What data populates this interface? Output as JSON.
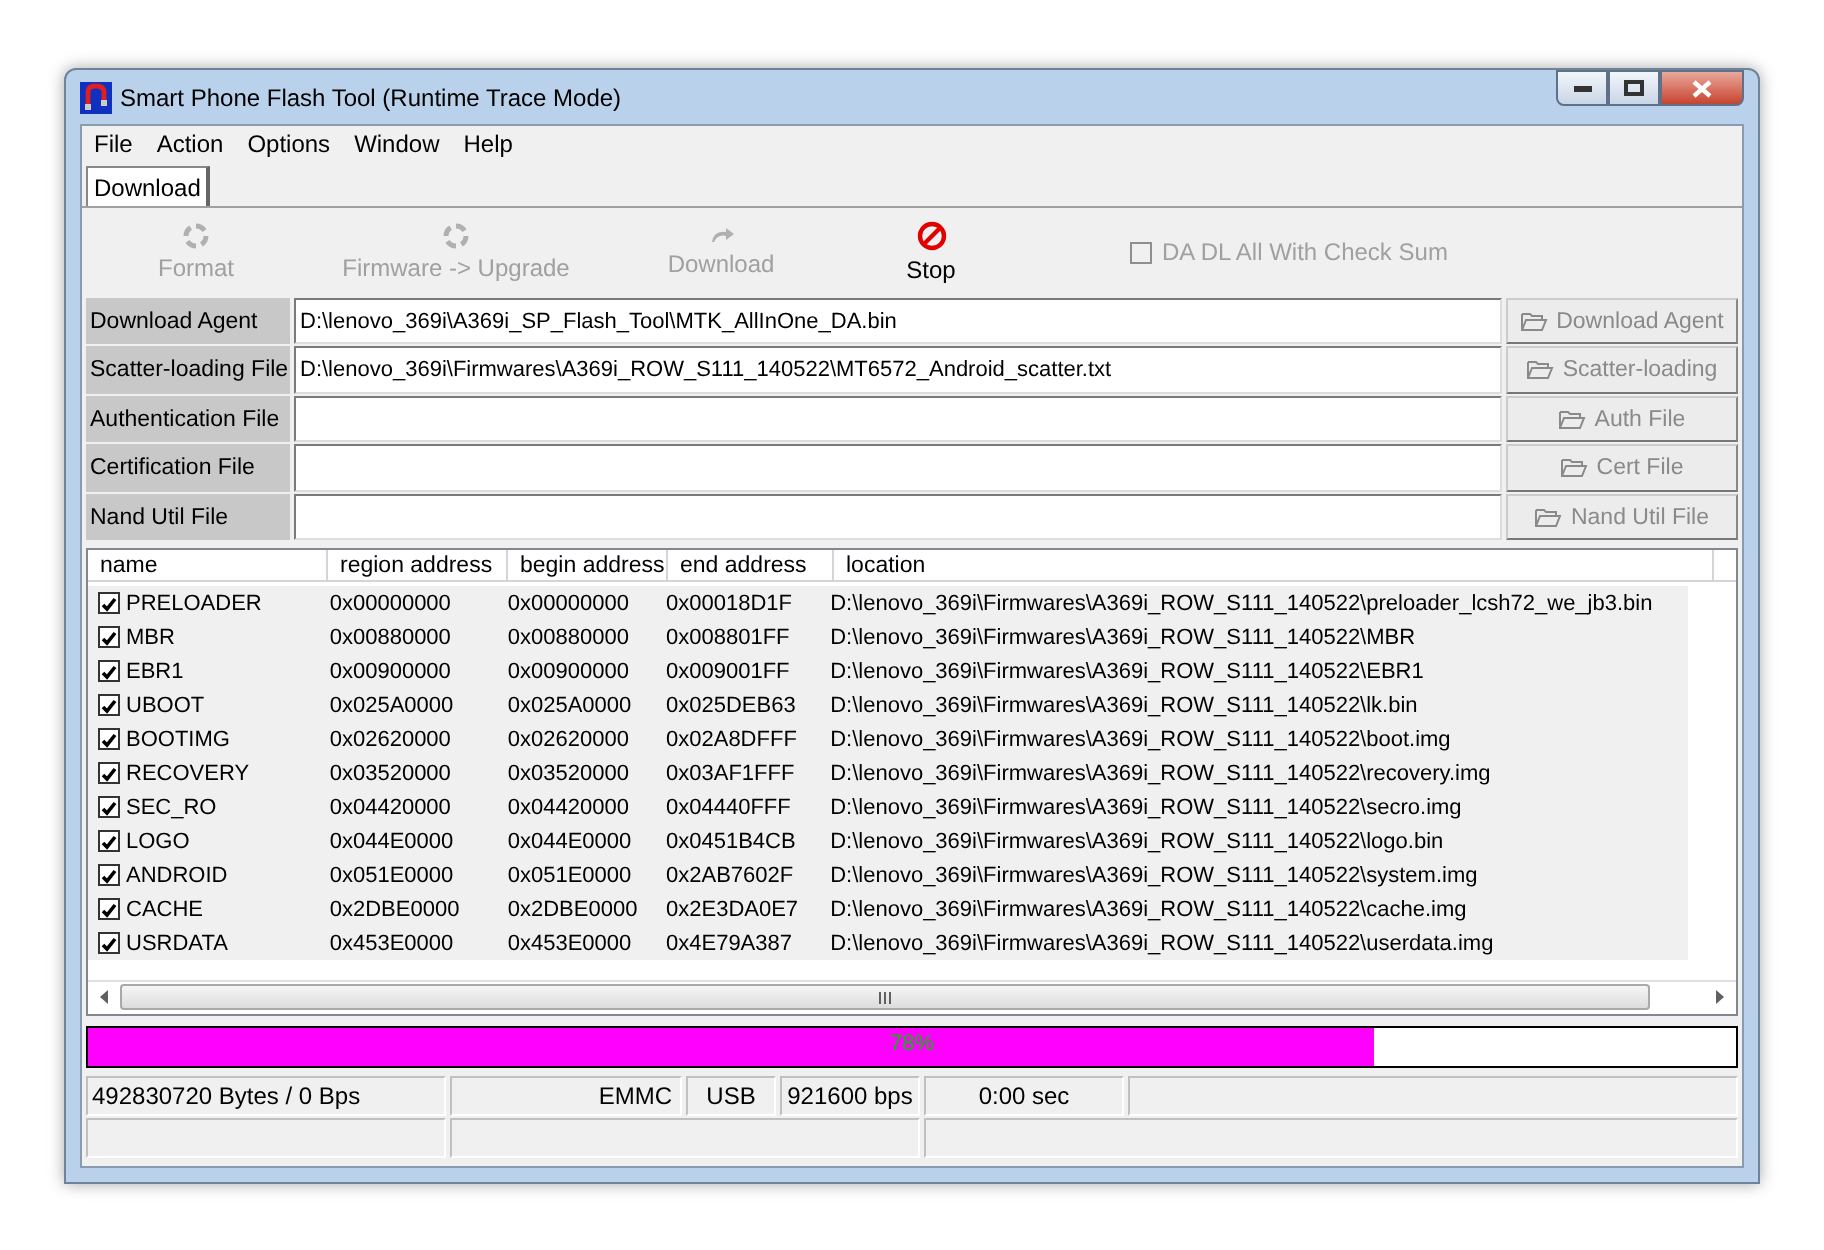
{
  "window": {
    "title": "Smart Phone Flash Tool (Runtime Trace Mode)"
  },
  "menu": [
    "File",
    "Action",
    "Options",
    "Window",
    "Help"
  ],
  "tabs": [
    {
      "label": "Download",
      "selected": true
    }
  ],
  "toolbar": [
    {
      "kind": "format",
      "label": "Format",
      "disabled": true
    },
    {
      "kind": "upgrade",
      "label": "Firmware -> Upgrade",
      "disabled": true
    },
    {
      "kind": "download",
      "label": "Download",
      "disabled": true
    },
    {
      "kind": "stop",
      "label": "Stop",
      "disabled": false
    }
  ],
  "checksum": {
    "label": "DA DL All With Check Sum",
    "checked": false,
    "disabled": true
  },
  "file_rows": [
    {
      "label": "Download Agent",
      "value": "D:\\lenovo_369i\\A369i_SP_Flash_Tool\\MTK_AllInOne_DA.bin",
      "button": "Download Agent"
    },
    {
      "label": "Scatter-loading File",
      "value": "D:\\lenovo_369i\\Firmwares\\A369i_ROW_S111_140522\\MT6572_Android_scatter.txt",
      "button": "Scatter-loading"
    },
    {
      "label": "Authentication File",
      "button": "Auth File"
    },
    {
      "label": "Certification File",
      "button": "Cert File"
    },
    {
      "label": "Nand Util File",
      "button": "Nand Util File"
    }
  ],
  "table": {
    "columns": [
      "name",
      "region address",
      "begin address",
      "end address",
      "location"
    ],
    "rows": [
      {
        "checked": true,
        "name": "PRELOADER",
        "region": "0x00000000",
        "begin": "0x00000000",
        "end": "0x00018D1F",
        "location": "D:\\lenovo_369i\\Firmwares\\A369i_ROW_S111_140522\\preloader_lcsh72_we_jb3.bin"
      },
      {
        "checked": true,
        "name": "MBR",
        "region": "0x00880000",
        "begin": "0x00880000",
        "end": "0x008801FF",
        "location": "D:\\lenovo_369i\\Firmwares\\A369i_ROW_S111_140522\\MBR"
      },
      {
        "checked": true,
        "name": "EBR1",
        "region": "0x00900000",
        "begin": "0x00900000",
        "end": "0x009001FF",
        "location": "D:\\lenovo_369i\\Firmwares\\A369i_ROW_S111_140522\\EBR1"
      },
      {
        "checked": true,
        "name": "UBOOT",
        "region": "0x025A0000",
        "begin": "0x025A0000",
        "end": "0x025DEB63",
        "location": "D:\\lenovo_369i\\Firmwares\\A369i_ROW_S111_140522\\lk.bin"
      },
      {
        "checked": true,
        "name": "BOOTIMG",
        "region": "0x02620000",
        "begin": "0x02620000",
        "end": "0x02A8DFFF",
        "location": "D:\\lenovo_369i\\Firmwares\\A369i_ROW_S111_140522\\boot.img"
      },
      {
        "checked": true,
        "name": "RECOVERY",
        "region": "0x03520000",
        "begin": "0x03520000",
        "end": "0x03AF1FFF",
        "location": "D:\\lenovo_369i\\Firmwares\\A369i_ROW_S111_140522\\recovery.img"
      },
      {
        "checked": true,
        "name": "SEC_RO",
        "region": "0x04420000",
        "begin": "0x04420000",
        "end": "0x04440FFF",
        "location": "D:\\lenovo_369i\\Firmwares\\A369i_ROW_S111_140522\\secro.img"
      },
      {
        "checked": true,
        "name": "LOGO",
        "region": "0x044E0000",
        "begin": "0x044E0000",
        "end": "0x0451B4CB",
        "location": "D:\\lenovo_369i\\Firmwares\\A369i_ROW_S111_140522\\logo.bin"
      },
      {
        "checked": true,
        "name": "ANDROID",
        "region": "0x051E0000",
        "begin": "0x051E0000",
        "end": "0x2AB7602F",
        "location": "D:\\lenovo_369i\\Firmwares\\A369i_ROW_S111_140522\\system.img"
      },
      {
        "checked": true,
        "name": "CACHE",
        "region": "0x2DBE0000",
        "begin": "0x2DBE0000",
        "end": "0x2E3DA0E7",
        "location": "D:\\lenovo_369i\\Firmwares\\A369i_ROW_S111_140522\\cache.img"
      },
      {
        "checked": true,
        "name": "USRDATA",
        "region": "0x453E0000",
        "begin": "0x453E0000",
        "end": "0x4E79A387",
        "location": "D:\\lenovo_369i\\Firmwares\\A369i_ROW_S111_140522\\userdata.img"
      }
    ]
  },
  "progress": {
    "level": 0.78,
    "reading": "78%"
  },
  "status_bar": [
    "492830720 Bytes / 0 Bps",
    "EMMC",
    "USB",
    "921600 bps",
    "0:00 sec"
  ]
}
